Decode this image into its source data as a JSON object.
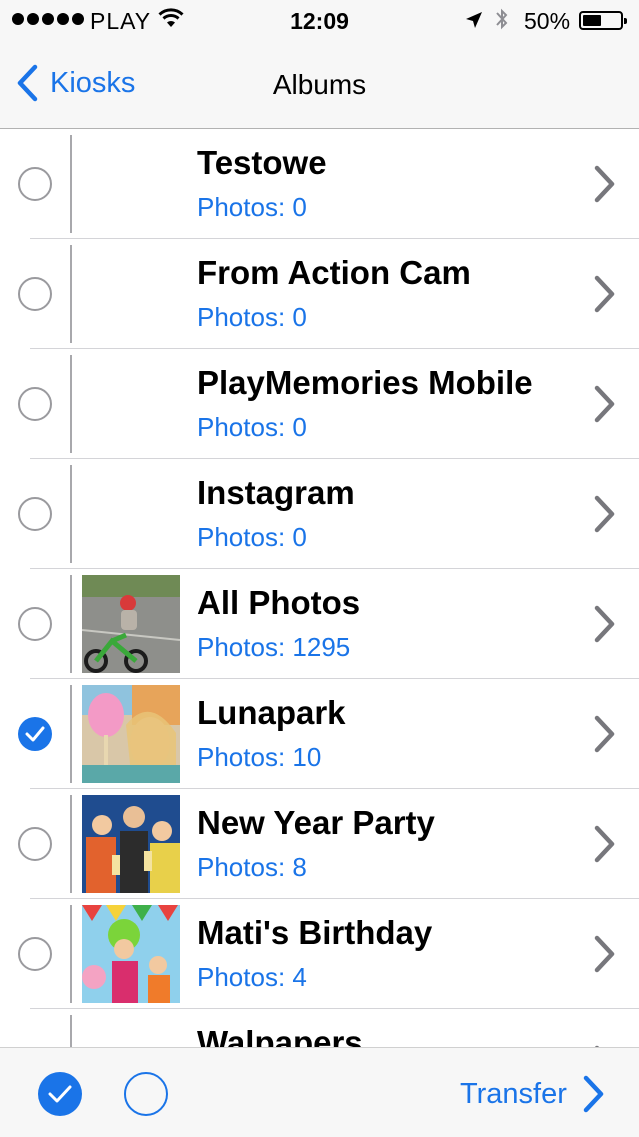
{
  "status_bar": {
    "carrier": "PLAY",
    "time": "12:09",
    "battery_text": "50%",
    "battery_level": 0.5,
    "icons": [
      "signal-dots-icon",
      "wifi-icon",
      "location-arrow-icon",
      "bluetooth-icon",
      "battery-icon"
    ]
  },
  "nav": {
    "back_label": "Kiosks",
    "title": "Albums"
  },
  "albums": [
    {
      "name": "Testowe",
      "count": "Photos: 0",
      "selected": false,
      "thumb": "none"
    },
    {
      "name": "From Action Cam",
      "count": "Photos: 0",
      "selected": false,
      "thumb": "none"
    },
    {
      "name": "PlayMemories Mobile",
      "count": "Photos: 0",
      "selected": false,
      "thumb": "none"
    },
    {
      "name": "Instagram",
      "count": "Photos: 0",
      "selected": false,
      "thumb": "none"
    },
    {
      "name": "All Photos",
      "count": "Photos: 1295",
      "selected": false,
      "thumb": "child-on-bike-photo"
    },
    {
      "name": "Lunapark",
      "count": "Photos: 10",
      "selected": true,
      "thumb": "cotton-candy-photo"
    },
    {
      "name": "New Year Party",
      "count": "Photos: 8",
      "selected": false,
      "thumb": "party-photo"
    },
    {
      "name": "Mati's Birthday",
      "count": "Photos: 4",
      "selected": false,
      "thumb": "birthday-clown-photo"
    },
    {
      "name": "Walpapers",
      "count": "",
      "selected": false,
      "thumb": "none"
    }
  ],
  "toolbar": {
    "transfer_label": "Transfer"
  },
  "colors": {
    "accent": "#1a74e8",
    "bar_background": "#f7f7f7",
    "separator": "#d4d4d8"
  }
}
